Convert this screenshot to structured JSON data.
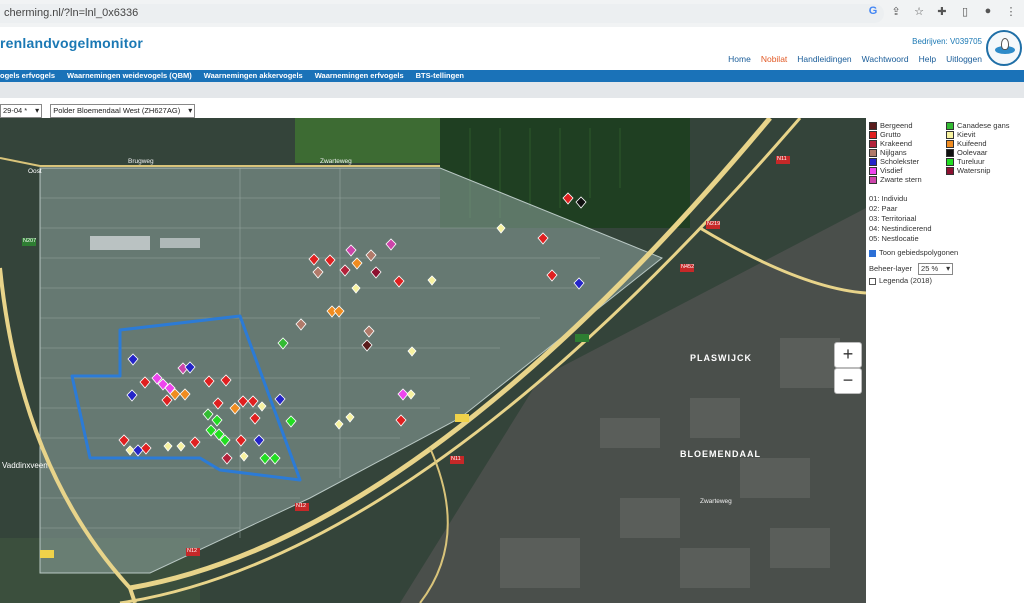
{
  "browser": {
    "url": "cherming.nl/?ln=lnl_0x6336",
    "icons": [
      "google-icon",
      "share-icon",
      "star-icon",
      "extension-icon",
      "sidepanel-icon",
      "profile-icon",
      "menu-icon"
    ]
  },
  "header": {
    "brand": "renlandvogelmonitor",
    "account": "Bedrijven: V039705",
    "nav": [
      "Home",
      "Nobilat",
      "Handleidingen",
      "Wachtwoord",
      "Help",
      "Uitloggen"
    ],
    "active_nav": "Nobilat"
  },
  "menu": [
    "ogels erfvogels",
    "Waarnemingen weidevogels (QBM)",
    "Waarnemingen akkervogels",
    "Waarnemingen erfvogels",
    "BTS-tellingen"
  ],
  "controls": {
    "date": "29-04 *",
    "area": "Polder Bloemendaal West (ZH627AG)"
  },
  "map": {
    "zoom_in": "+",
    "zoom_out": "−",
    "labels": {
      "brugweg": "Brugweg",
      "zwarteweg": "Zwarteweg",
      "zwarteweg2": "Zwarteweg",
      "plaswijck": "PLASWIJCK",
      "bloemendaal": "BLOEMENDAAL",
      "vaddinxveen": "Vaddinxveen",
      "oost": "Oost",
      "road_n207": "N207",
      "road_n219": "N219",
      "road_n452": "N452",
      "road_n11": "N11",
      "road_n11b": "N11",
      "road_n12": "N12",
      "road_n12b": "N12"
    },
    "colors": {
      "polygon": "#8fa5a0",
      "area_outline": "#2c7bd6"
    }
  },
  "legend": {
    "species_left": [
      {
        "name": "Bergeend",
        "color": "#5a1c1c"
      },
      {
        "name": "Grutto",
        "color": "#e02020"
      },
      {
        "name": "Krakeend",
        "color": "#b2223a"
      },
      {
        "name": "Nijlgans",
        "color": "#b07a6a"
      },
      {
        "name": "Scholekster",
        "color": "#2424c8"
      },
      {
        "name": "Visdief",
        "color": "#ee44ee"
      },
      {
        "name": "Zwarte stern",
        "color": "#cc44aa"
      }
    ],
    "species_right": [
      {
        "name": "Canadese gans",
        "color": "#33bb33"
      },
      {
        "name": "Kievit",
        "color": "#f7f2a0"
      },
      {
        "name": "Kuifeend",
        "color": "#f08c20"
      },
      {
        "name": "Oolevaar",
        "color": "#101010"
      },
      {
        "name": "Tureluur",
        "color": "#22dd22"
      },
      {
        "name": "Watersnip",
        "color": "#8c1030"
      }
    ],
    "codes": [
      "01: Individu",
      "02: Paar",
      "03: Territoriaal",
      "04: Nestindicerend",
      "05: Nestlocatie"
    ],
    "toon_label": "Toon gebiedspolygonen",
    "beheer_label": "Beheer-layer",
    "beheer_value": "25 %",
    "legenda_label": "Legenda (2018)"
  }
}
